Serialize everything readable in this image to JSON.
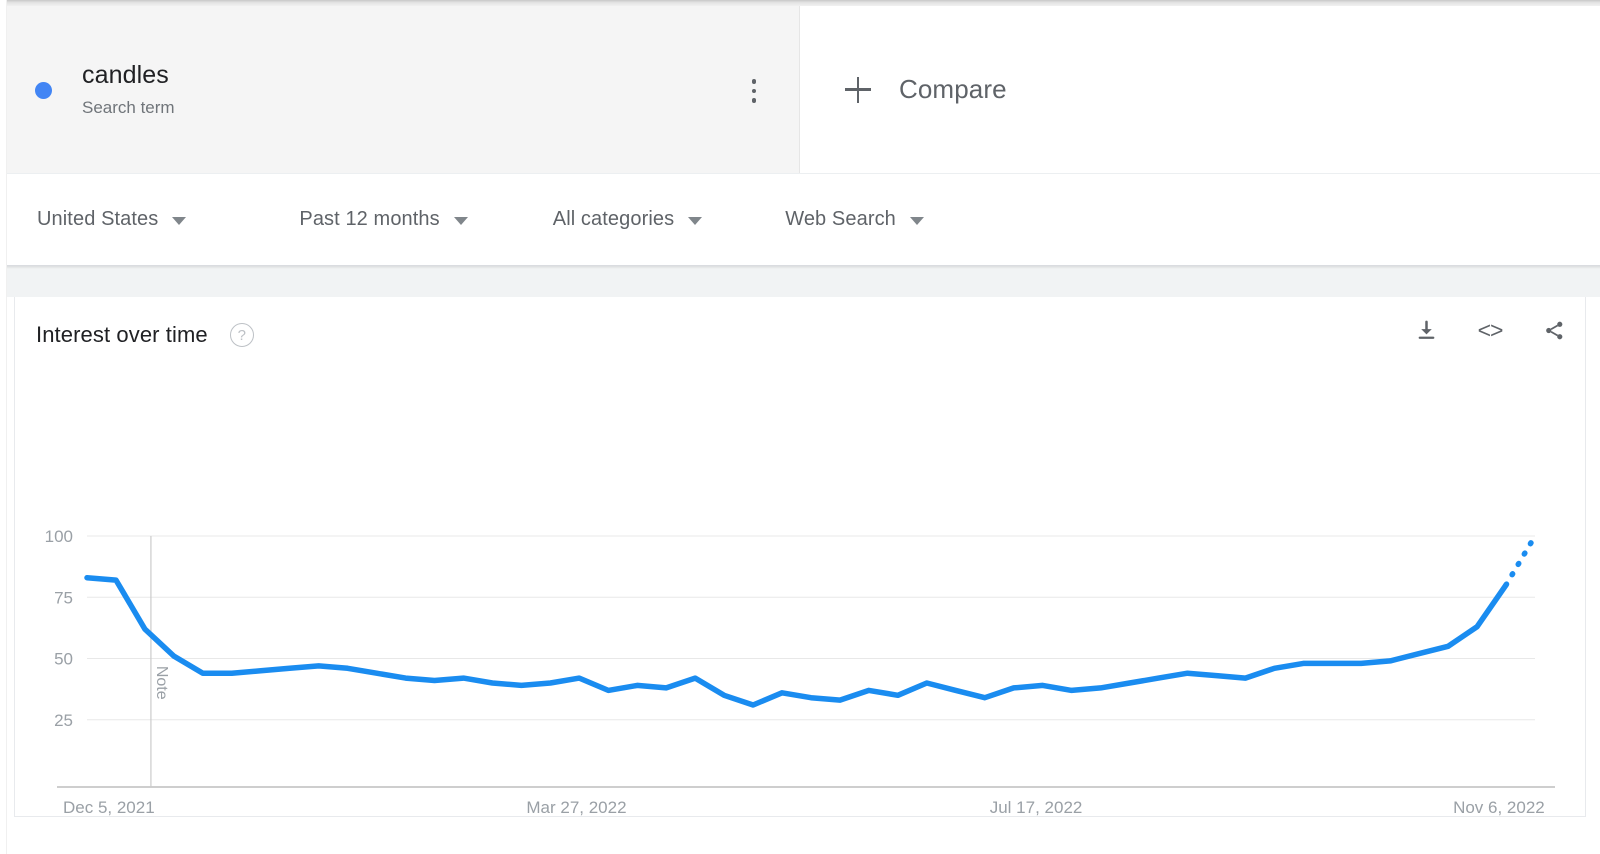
{
  "header": {
    "term": {
      "name": "candles",
      "type_label": "Search term",
      "dot_color": "#4285f4",
      "menu_icon": "more-vert-icon"
    },
    "compare": {
      "label": "Compare",
      "icon": "plus-icon"
    }
  },
  "filters": [
    {
      "label": "United States",
      "icon": "chevron-down-icon"
    },
    {
      "label": "Past 12 months",
      "icon": "chevron-down-icon"
    },
    {
      "label": "All categories",
      "icon": "chevron-down-icon"
    },
    {
      "label": "Web Search",
      "icon": "chevron-down-icon"
    }
  ],
  "card": {
    "title": "Interest over time",
    "help_icon": "help-circle-icon",
    "help_glyph": "?",
    "actions": [
      {
        "name": "download-icon",
        "tooltip": "Download"
      },
      {
        "name": "embed-icon",
        "tooltip": "Embed",
        "glyph": "<>"
      },
      {
        "name": "share-icon",
        "tooltip": "Share"
      }
    ]
  },
  "chart_data": {
    "type": "line",
    "title": "Interest over time",
    "xlabel": "",
    "ylabel": "",
    "ylim": [
      0,
      100
    ],
    "y_ticks": [
      25,
      50,
      75,
      100
    ],
    "x_tick_labels": [
      "Dec 5, 2021",
      "Mar 27, 2022",
      "Jul 17, 2022",
      "Nov 6, 2022"
    ],
    "x_tick_positions": [
      0,
      16,
      32,
      48
    ],
    "grid": true,
    "legend_position": "none",
    "line_color": "#1a8cf0",
    "annotations": [
      {
        "text": "Note",
        "x_index": 2,
        "orientation": "vertical",
        "type": "note-line"
      }
    ],
    "series": [
      {
        "name": "candles",
        "color": "#1a8cf0",
        "values": [
          83,
          82,
          62,
          51,
          44,
          44,
          45,
          46,
          47,
          46,
          44,
          42,
          41,
          42,
          40,
          39,
          40,
          42,
          37,
          39,
          38,
          42,
          35,
          31,
          36,
          34,
          33,
          37,
          35,
          40,
          37,
          34,
          38,
          39,
          37,
          38,
          40,
          42,
          44,
          43,
          42,
          46,
          48,
          48,
          48,
          49,
          52,
          55,
          63,
          80
        ],
        "partial_tail": {
          "from_index": 49,
          "to_value": 100,
          "style": "dotted"
        }
      }
    ]
  }
}
